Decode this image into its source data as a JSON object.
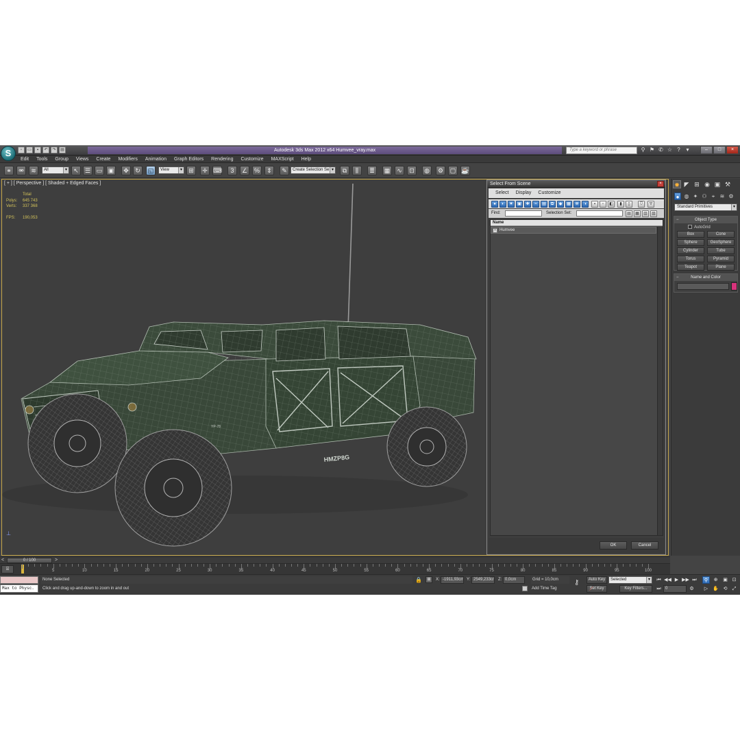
{
  "window": {
    "app_logo": "S",
    "title": "Autodesk 3ds Max  2012 x64      Humvee_vray.max",
    "search_placeholder": "Type a keyword or phrase",
    "controls": {
      "minimize": "–",
      "maximize": "□",
      "close": "×"
    }
  },
  "quick_access": [
    "new-icon",
    "open-icon",
    "save-icon",
    "undo-icon",
    "redo-icon",
    "project-icon"
  ],
  "menu": [
    "Edit",
    "Tools",
    "Group",
    "Views",
    "Create",
    "Modifiers",
    "Animation",
    "Graph Editors",
    "Rendering",
    "Customize",
    "MAXScript",
    "Help"
  ],
  "toolbar": {
    "selection_filter": "All",
    "reference_coord": "View",
    "named_selection_placeholder": "Create Selection Se"
  },
  "viewport": {
    "label": "[ + ] [ Perspective ] [ Shaded + Edged Faces ]",
    "stats": {
      "header": "Total",
      "polys_label": "Polys:",
      "polys_value": "645 743",
      "verts_label": "Verts:",
      "verts_value": "337 368",
      "fps_label": "FPS:",
      "fps_value": "190,053"
    },
    "vehicle_markings": {
      "plate": "HMZP8G",
      "front": "YP-78"
    }
  },
  "select_dialog": {
    "title": "Select From Scene",
    "close": "×",
    "menu": [
      "Select",
      "Display",
      "Customize"
    ],
    "find_label": "Find:",
    "find_value": "",
    "selection_set_label": "Selection Set:",
    "column_name": "Name",
    "rows": [
      {
        "name": "Humvee"
      }
    ],
    "ok": "OK",
    "cancel": "Cancel"
  },
  "command_panel": {
    "category": "Standard Primitives",
    "object_type_title": "Object Type",
    "autogrid": "AutoGrid",
    "objects": [
      "Box",
      "Cone",
      "Sphere",
      "GeoSphere",
      "Cylinder",
      "Tube",
      "Torus",
      "Pyramid",
      "Teapot",
      "Plane"
    ],
    "name_color_title": "Name and Color",
    "object_color": "#d7337b"
  },
  "timeline": {
    "left_arrow": "<",
    "frame_display": "0 / 100",
    "right_arrow": ">",
    "ticks": [
      "5",
      "10",
      "15",
      "20",
      "25",
      "30",
      "35",
      "40",
      "45",
      "50",
      "55",
      "60",
      "65",
      "70",
      "75",
      "80",
      "85",
      "90",
      "95",
      "100"
    ]
  },
  "status": {
    "maxscript_listener": "Max to Physc.",
    "selection": "None Selected",
    "prompt": "Click and drag up-and-down to zoom in and out",
    "x_label": "X:",
    "x_value": "-1911,93cm",
    "y_label": "Y:",
    "y_value": "2549,233cm",
    "z_label": "Z:",
    "z_value": "0,0cm",
    "grid": "Grid = 10,0cm",
    "add_time_tag": "Add Time Tag",
    "auto_key": "Auto Key",
    "set_key": "Set Key",
    "selected_dropdown": "Selected",
    "key_filters": "Key Filters...",
    "current_frame": "0"
  }
}
